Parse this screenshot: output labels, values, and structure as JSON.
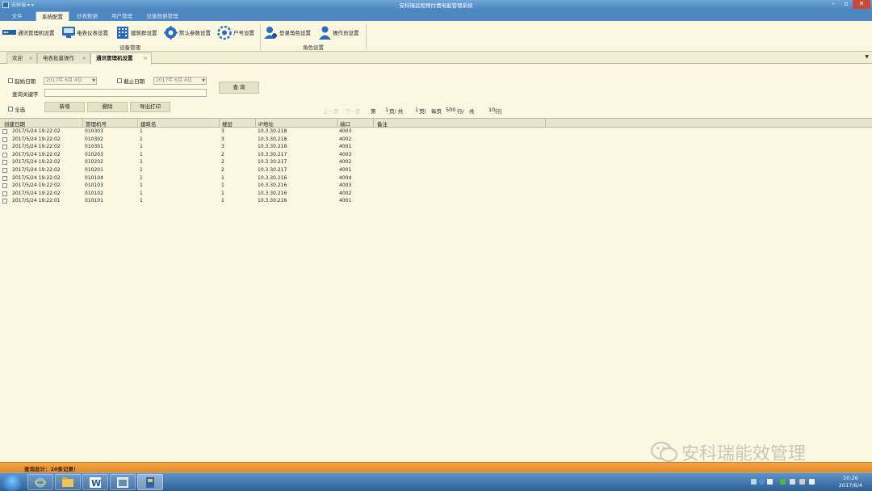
{
  "window": {
    "title": "安科瑞远程预付费电能管理系统",
    "quick_access": "安科瑞 ▾ ▾"
  },
  "menu_tabs": [
    {
      "label": "文件",
      "active": false
    },
    {
      "label": "系统配置",
      "active": true
    },
    {
      "label": "抄表数据",
      "active": false
    },
    {
      "label": "用户管理",
      "active": false
    },
    {
      "label": "设备数据管理",
      "active": false
    }
  ],
  "ribbon": {
    "groups": [
      {
        "label": "设备管理",
        "buttons": [
          {
            "label": "通讯管理机设置",
            "icon": "network-device-icon"
          },
          {
            "label": "电表仪表设置",
            "icon": "meter-icon"
          },
          {
            "label": "建筑群设置",
            "icon": "building-icon"
          },
          {
            "label": "默认参数设置",
            "icon": "gear-icon"
          },
          {
            "label": "户号设置",
            "icon": "cog-group-icon"
          }
        ]
      },
      {
        "label": "角色设置",
        "buttons": [
          {
            "label": "登录角色设置",
            "icon": "user-role-icon"
          },
          {
            "label": "操作员设置",
            "icon": "operator-icon"
          }
        ]
      }
    ]
  },
  "doc_tabs": [
    {
      "label": "欢迎",
      "active": false
    },
    {
      "label": "电表批量操作",
      "active": false
    },
    {
      "label": "通讯管理机设置",
      "active": true
    }
  ],
  "filter": {
    "start_date_label": "起始日期",
    "start_date_value": "2017年 6月 4日",
    "end_date_label": "截止日期",
    "end_date_value": "2017年 6月 4日",
    "query_button": "查 询",
    "keyword_label": "查询关键字",
    "keyword_value": "",
    "select_all_label": "全选",
    "add_button": "新增",
    "delete_button": "删除",
    "export_button": "导出打印"
  },
  "pager": {
    "prev": "上一页",
    "next": "下一页",
    "page_prefix": "第",
    "page_current": "1",
    "page_mid": "页/ 共",
    "page_total": "1",
    "page_suffix": "页|",
    "per_page_label": "每页",
    "per_page_value": "500",
    "per_page_unit": "行/",
    "total_label": "共",
    "total_value": "10",
    "total_unit": "行|"
  },
  "table": {
    "columns": [
      "创建日期",
      "管理机号",
      "建筑名",
      "楼层",
      "IP地址",
      "端口",
      "备注"
    ],
    "rows": [
      [
        "2017/5/24 19:22:02",
        "010303",
        "1",
        "3",
        "10.3.30.218",
        "4003",
        ""
      ],
      [
        "2017/5/24 19:22:02",
        "010302",
        "1",
        "3",
        "10.3.30.218",
        "4002",
        ""
      ],
      [
        "2017/5/24 19:22:02",
        "010301",
        "1",
        "3",
        "10.3.30.218",
        "4001",
        ""
      ],
      [
        "2017/5/24 19:22:02",
        "010203",
        "1",
        "2",
        "10.3.30.217",
        "4003",
        ""
      ],
      [
        "2017/5/24 19:22:02",
        "010202",
        "1",
        "2",
        "10.3.30.217",
        "4002",
        ""
      ],
      [
        "2017/5/24 19:22:02",
        "010201",
        "1",
        "2",
        "10.3.30.217",
        "4001",
        ""
      ],
      [
        "2017/5/24 19:22:02",
        "010104",
        "1",
        "1",
        "10.3.30.216",
        "4004",
        ""
      ],
      [
        "2017/5/24 19:22:02",
        "010103",
        "1",
        "1",
        "10.3.30.216",
        "4003",
        ""
      ],
      [
        "2017/5/24 19:22:02",
        "010102",
        "1",
        "1",
        "10.3.30.216",
        "4002",
        ""
      ],
      [
        "2017/5/24 19:22:01",
        "010101",
        "1",
        "1",
        "10.3.30.216",
        "4001",
        ""
      ]
    ]
  },
  "status": {
    "text": "查询总计：10条记录！"
  },
  "watermark": {
    "text": "安科瑞能效管理"
  },
  "taskbar": {
    "time": "10:26",
    "date": "2017/6/4"
  },
  "colors": {
    "background": "#fbf8e1",
    "ribbon_blue": "#4e86c1",
    "status_orange": "#e58a1f"
  }
}
